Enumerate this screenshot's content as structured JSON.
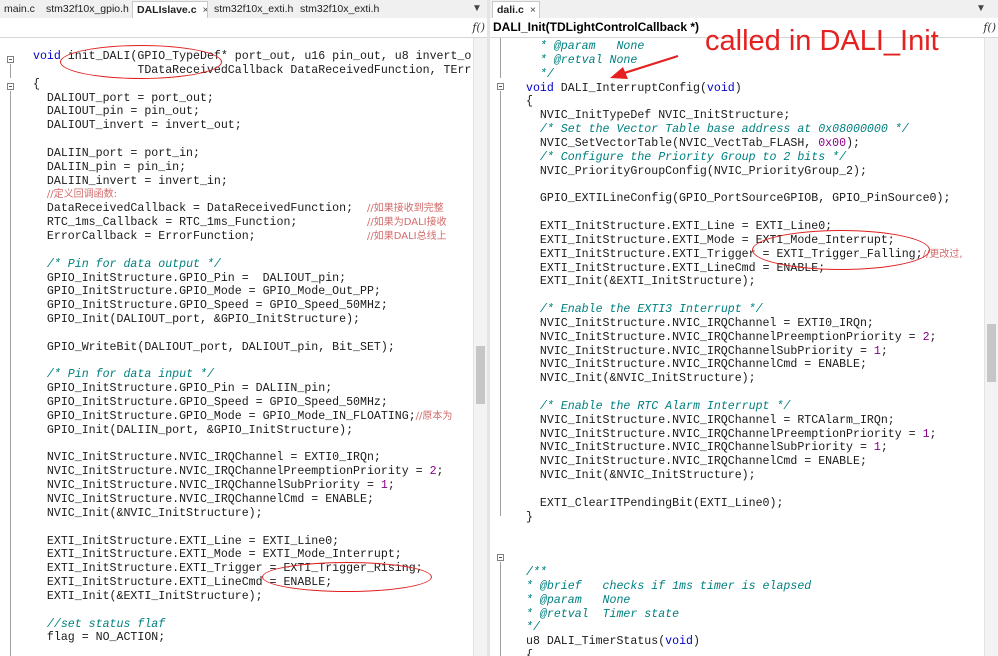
{
  "left_pane": {
    "tabs": [
      {
        "label": "main.c"
      },
      {
        "label": "stm32f10x_gpio.h"
      },
      {
        "label": "DALIslave.c",
        "close": "×"
      },
      {
        "label": "stm32f10x_exti.h"
      },
      {
        "label": "stm32f10x_exti.h"
      }
    ],
    "tab_arrow": "▼",
    "func_glyph": "f()",
    "code": [
      [
        [
          "kw",
          "void"
        ],
        [
          "t",
          " init_DALI(GPIO_TypeDef* port_out, u16 pin_out, u8 invert_o"
        ]
      ],
      [
        [
          "t",
          "               TDataReceivedCallback DataReceivedFunction, TErr"
        ]
      ],
      [
        [
          "t",
          "{"
        ]
      ],
      [
        [
          "t",
          "  DALIOUT_port = port_out;"
        ]
      ],
      [
        [
          "t",
          "  DALIOUT_pin = pin_out;"
        ]
      ],
      [
        [
          "t",
          "  DALIOUT_invert = invert_out;"
        ]
      ],
      [
        [
          "t",
          ""
        ]
      ],
      [
        [
          "t",
          "  DALIIN_port = port_in;"
        ]
      ],
      [
        [
          "t",
          "  DALIIN_pin = pin_in;"
        ]
      ],
      [
        [
          "t",
          "  DALIIN_invert = invert_in;"
        ]
      ],
      [
        [
          "t",
          "  "
        ],
        [
          "zh",
          "//定义回调函数:"
        ]
      ],
      [
        [
          "t",
          "  DataReceivedCallback = DataReceivedFunction;  "
        ],
        [
          "zh",
          "//如果接收到完整"
        ]
      ],
      [
        [
          "t",
          "  RTC_1ms_Callback = RTC_1ms_Function;          "
        ],
        [
          "zh",
          "//如果为DALI接收"
        ]
      ],
      [
        [
          "t",
          "  ErrorCallback = ErrorFunction;                "
        ],
        [
          "zh",
          "//如果DALI总线上"
        ]
      ],
      [
        [
          "t",
          ""
        ]
      ],
      [
        [
          "t",
          "  "
        ],
        [
          "cm",
          "/* Pin for data output */"
        ]
      ],
      [
        [
          "t",
          "  GPIO_InitStructure.GPIO_Pin =  DALIOUT_pin;"
        ]
      ],
      [
        [
          "t",
          "  GPIO_InitStructure.GPIO_Mode = GPIO_Mode_Out_PP;"
        ]
      ],
      [
        [
          "t",
          "  GPIO_InitStructure.GPIO_Speed = GPIO_Speed_50MHz;"
        ]
      ],
      [
        [
          "t",
          "  GPIO_Init(DALIOUT_port, &GPIO_InitStructure);"
        ]
      ],
      [
        [
          "t",
          ""
        ]
      ],
      [
        [
          "t",
          "  GPIO_WriteBit(DALIOUT_port, DALIOUT_pin, Bit_SET);"
        ]
      ],
      [
        [
          "t",
          ""
        ]
      ],
      [
        [
          "t",
          "  "
        ],
        [
          "cm",
          "/* Pin for data input */"
        ]
      ],
      [
        [
          "t",
          "  GPIO_InitStructure.GPIO_Pin = DALIIN_pin;"
        ]
      ],
      [
        [
          "t",
          "  GPIO_InitStructure.GPIO_Speed = GPIO_Speed_50MHz;"
        ]
      ],
      [
        [
          "t",
          "  GPIO_InitStructure.GPIO_Mode = GPIO_Mode_IN_FLOATING;"
        ],
        [
          "zh",
          "//原本为"
        ]
      ],
      [
        [
          "t",
          "  GPIO_Init(DALIIN_port, &GPIO_InitStructure);"
        ]
      ],
      [
        [
          "t",
          ""
        ]
      ],
      [
        [
          "t",
          "  NVIC_InitStructure.NVIC_IRQChannel = EXTI0_IRQn;"
        ]
      ],
      [
        [
          "t",
          "  NVIC_InitStructure.NVIC_IRQChannelPreemptionPriority = "
        ],
        [
          "num",
          "2"
        ],
        [
          "t",
          ";"
        ]
      ],
      [
        [
          "t",
          "  NVIC_InitStructure.NVIC_IRQChannelSubPriority = "
        ],
        [
          "num",
          "1"
        ],
        [
          "t",
          ";"
        ]
      ],
      [
        [
          "t",
          "  NVIC_InitStructure.NVIC_IRQChannelCmd = ENABLE;"
        ]
      ],
      [
        [
          "t",
          "  NVIC_Init(&NVIC_InitStructure);"
        ]
      ],
      [
        [
          "t",
          ""
        ]
      ],
      [
        [
          "t",
          "  EXTI_InitStructure.EXTI_Line = EXTI_Line0;"
        ]
      ],
      [
        [
          "t",
          "  EXTI_InitStructure.EXTI_Mode = EXTI_Mode_Interrupt;"
        ]
      ],
      [
        [
          "t",
          "  EXTI_InitStructure.EXTI_Trigger = EXTI_Trigger_Rising;"
        ]
      ],
      [
        [
          "t",
          "  EXTI_InitStructure.EXTI_LineCmd = ENABLE;"
        ]
      ],
      [
        [
          "t",
          "  EXTI_Init(&EXTI_InitStructure);"
        ]
      ],
      [
        [
          "t",
          ""
        ]
      ],
      [
        [
          "t",
          "  "
        ],
        [
          "cm",
          "//set status flaf"
        ]
      ],
      [
        [
          "t",
          "  flag = NO_ACTION;"
        ]
      ]
    ]
  },
  "right_pane": {
    "tabs": [
      {
        "label": "dali.c",
        "close": "×"
      }
    ],
    "tab_arrow": "▼",
    "function_dropdown": "DALI_Init(TDLightControlCallback *)",
    "func_glyph": "f()",
    "annotation": "called in DALI_Init",
    "code": [
      [
        [
          "t",
          "  "
        ],
        [
          "cm",
          "* @param   None"
        ]
      ],
      [
        [
          "t",
          "  "
        ],
        [
          "cm",
          "* @retval None"
        ]
      ],
      [
        [
          "t",
          "  "
        ],
        [
          "cm",
          "*/"
        ]
      ],
      [
        [
          "kw",
          "void"
        ],
        [
          "t",
          " DALI_InterruptConfig("
        ],
        [
          "kw",
          "void"
        ],
        [
          "t",
          ")"
        ]
      ],
      [
        [
          "t",
          "{"
        ]
      ],
      [
        [
          "t",
          "  NVIC_InitTypeDef NVIC_InitStructure;"
        ]
      ],
      [
        [
          "t",
          "  "
        ],
        [
          "cm",
          "/* Set the Vector Table base address at 0x08000000 */"
        ]
      ],
      [
        [
          "t",
          "  NVIC_SetVectorTable(NVIC_VectTab_FLASH, "
        ],
        [
          "num",
          "0x00"
        ],
        [
          "t",
          ");"
        ]
      ],
      [
        [
          "t",
          "  "
        ],
        [
          "cm",
          "/* Configure the Priority Group to 2 bits */"
        ]
      ],
      [
        [
          "t",
          "  NVIC_PriorityGroupConfig(NVIC_PriorityGroup_2);"
        ]
      ],
      [
        [
          "t",
          ""
        ]
      ],
      [
        [
          "t",
          "  GPIO_EXTILineConfig(GPIO_PortSourceGPIOB, GPIO_PinSource0);"
        ]
      ],
      [
        [
          "t",
          ""
        ]
      ],
      [
        [
          "t",
          "  EXTI_InitStructure.EXTI_Line = EXTI_Line0;"
        ]
      ],
      [
        [
          "t",
          "  EXTI_InitStructure.EXTI_Mode = EXTI_Mode_Interrupt;"
        ]
      ],
      [
        [
          "t",
          "  EXTI_InitStructure.EXTI_Trigger = EXTI_Trigger_Falling;"
        ],
        [
          "zh",
          "//更改过,"
        ]
      ],
      [
        [
          "t",
          "  EXTI_InitStructure.EXTI_LineCmd = ENABLE;"
        ]
      ],
      [
        [
          "t",
          "  EXTI_Init(&EXTI_InitStructure);"
        ]
      ],
      [
        [
          "t",
          ""
        ]
      ],
      [
        [
          "t",
          "  "
        ],
        [
          "cm",
          "/* Enable the EXTI3 Interrupt */"
        ]
      ],
      [
        [
          "t",
          "  NVIC_InitStructure.NVIC_IRQChannel = EXTI0_IRQn;"
        ]
      ],
      [
        [
          "t",
          "  NVIC_InitStructure.NVIC_IRQChannelPreemptionPriority = "
        ],
        [
          "num",
          "2"
        ],
        [
          "t",
          ";"
        ]
      ],
      [
        [
          "t",
          "  NVIC_InitStructure.NVIC_IRQChannelSubPriority = "
        ],
        [
          "num",
          "1"
        ],
        [
          "t",
          ";"
        ]
      ],
      [
        [
          "t",
          "  NVIC_InitStructure.NVIC_IRQChannelCmd = ENABLE;"
        ]
      ],
      [
        [
          "t",
          "  NVIC_Init(&NVIC_InitStructure);"
        ]
      ],
      [
        [
          "t",
          ""
        ]
      ],
      [
        [
          "t",
          "  "
        ],
        [
          "cm",
          "/* Enable the RTC Alarm Interrupt */"
        ]
      ],
      [
        [
          "t",
          "  NVIC_InitStructure.NVIC_IRQChannel = RTCAlarm_IRQn;"
        ]
      ],
      [
        [
          "t",
          "  NVIC_InitStructure.NVIC_IRQChannelPreemptionPriority = "
        ],
        [
          "num",
          "1"
        ],
        [
          "t",
          ";"
        ]
      ],
      [
        [
          "t",
          "  NVIC_InitStructure.NVIC_IRQChannelSubPriority = "
        ],
        [
          "num",
          "1"
        ],
        [
          "t",
          ";"
        ]
      ],
      [
        [
          "t",
          "  NVIC_InitStructure.NVIC_IRQChannelCmd = ENABLE;"
        ]
      ],
      [
        [
          "t",
          "  NVIC_Init(&NVIC_InitStructure);"
        ]
      ],
      [
        [
          "t",
          ""
        ]
      ],
      [
        [
          "t",
          "  EXTI_ClearITPendingBit(EXTI_Line0);"
        ]
      ],
      [
        [
          "t",
          "}"
        ]
      ],
      [
        [
          "t",
          ""
        ]
      ],
      [
        [
          "t",
          ""
        ]
      ],
      [
        [
          "t",
          ""
        ]
      ],
      [
        [
          "cm",
          "/**"
        ]
      ],
      [
        [
          "cm",
          "* @brief   checks if 1ms timer is elapsed"
        ]
      ],
      [
        [
          "cm",
          "* @param   None"
        ]
      ],
      [
        [
          "cm",
          "* @retval  Timer state"
        ]
      ],
      [
        [
          "cm",
          "*/"
        ]
      ],
      [
        [
          "t",
          "u8 DALI_TimerStatus("
        ],
        [
          "kw",
          "void"
        ],
        [
          "t",
          ")"
        ]
      ],
      [
        [
          "t",
          "{"
        ]
      ]
    ]
  },
  "colors": {
    "keyword": "#0000cc",
    "comment": "#008080",
    "chinese_comment": "#d46a6a",
    "number": "#8b008b",
    "annotation": "#e52020"
  }
}
